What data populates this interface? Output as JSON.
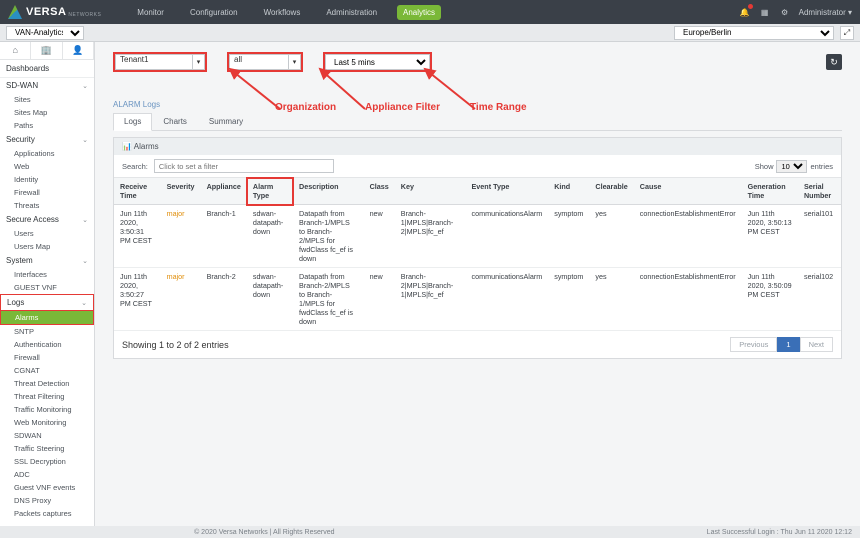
{
  "brand": {
    "name": "VERSA",
    "sub": "NETWORKS"
  },
  "topnav": {
    "monitor": "Monitor",
    "configuration": "Configuration",
    "workflows": "Workflows",
    "administration": "Administration",
    "analytics": "Analytics"
  },
  "topright": {
    "admin_label": "Administrator"
  },
  "subbar": {
    "context": "VAN-Analytics-1"
  },
  "sidebar": {
    "dashboards": "Dashboards",
    "sdwan": "SD-WAN",
    "sdwan_items": [
      "Sites",
      "Sites Map",
      "Paths"
    ],
    "security": "Security",
    "security_items": [
      "Applications",
      "Web",
      "Identity",
      "Firewall",
      "Threats"
    ],
    "secure_access": "Secure Access",
    "secure_access_items": [
      "Users",
      "Users Map"
    ],
    "system": "System",
    "system_items": [
      "Interfaces",
      "GUEST VNF"
    ],
    "logs": "Logs",
    "logs_items": [
      "Alarms",
      "SNTP",
      "Authentication",
      "Firewall",
      "CGNAT",
      "Threat Detection",
      "Threat Filtering",
      "Traffic Monitoring",
      "Web Monitoring",
      "SDWAN",
      "Traffic Steering",
      "SSL Decryption",
      "ADC",
      "Guest VNF events",
      "DNS Proxy",
      "Packets captures"
    ]
  },
  "filters": {
    "org": "Tenant1",
    "appliance": "all",
    "timerange": "Last 5 mins",
    "tz": "Europe/Berlin"
  },
  "annot": {
    "org": "Organization",
    "appliance": "Appliance Filter",
    "time": "Time Range"
  },
  "section": "ALARM Logs",
  "tabs": {
    "logs": "Logs",
    "charts": "Charts",
    "summary": "Summary"
  },
  "panel_title": "Alarms",
  "search": {
    "label": "Search:",
    "placeholder": "Click to set a filter"
  },
  "show": {
    "show": "Show",
    "entries": "entries",
    "n": "10"
  },
  "columns": [
    "Receive Time",
    "Severity",
    "Appliance",
    "Alarm Type",
    "Description",
    "Class",
    "Key",
    "Event Type",
    "Kind",
    "Clearable",
    "Cause",
    "Generation Time",
    "Serial Number"
  ],
  "rows": [
    {
      "rt": "Jun 11th 2020, 3:50:31 PM CEST",
      "sev": "major",
      "app": "Branch-1",
      "atype": "sdwan-datapath-down",
      "desc": "Datapath from Branch-1/MPLS to Branch-2/MPLS for fwdClass fc_ef is down",
      "cls": "new",
      "key": "Branch-1|MPLS|Branch-2|MPLS|fc_ef",
      "et": "communicationsAlarm",
      "kind": "symptom",
      "clr": "yes",
      "cause": "connectionEstablishmentError",
      "gt": "Jun 11th 2020, 3:50:13 PM CEST",
      "sn": "serial101"
    },
    {
      "rt": "Jun 11th 2020, 3:50:27 PM CEST",
      "sev": "major",
      "app": "Branch-2",
      "atype": "sdwan-datapath-down",
      "desc": "Datapath from Branch-2/MPLS to Branch-1/MPLS for fwdClass fc_ef is down",
      "cls": "new",
      "key": "Branch-2|MPLS|Branch-1|MPLS|fc_ef",
      "et": "communicationsAlarm",
      "kind": "symptom",
      "clr": "yes",
      "cause": "connectionEstablishmentError",
      "gt": "Jun 11th 2020, 3:50:09 PM CEST",
      "sn": "serial102"
    }
  ],
  "table_info": "Showing 1 to 2 of 2 entries",
  "pager": {
    "prev": "Previous",
    "page": "1",
    "next": "Next"
  },
  "footer": {
    "copy": "© 2020 Versa Networks | All Rights Reserved",
    "login": "Last Successful Login : Thu Jun 11 2020 12:12"
  }
}
